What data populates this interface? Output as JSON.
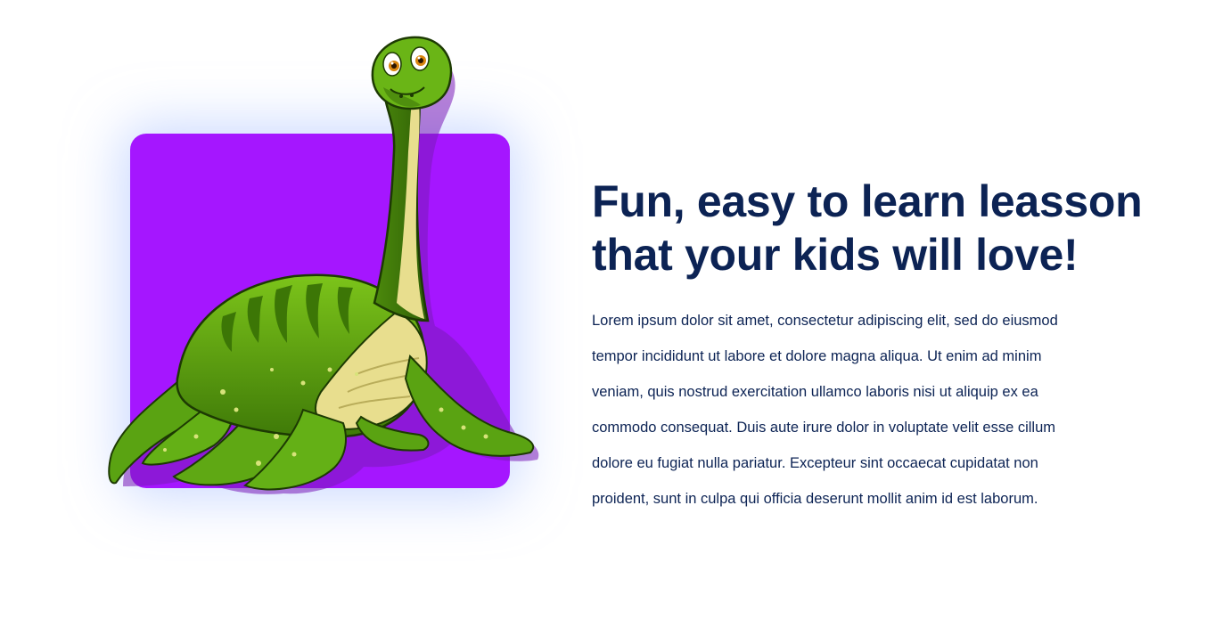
{
  "colors": {
    "card_purple": "#a516ff",
    "card_glow": "#a0b9ff",
    "heading_navy": "#0c2354",
    "dino_green": "#5aa312",
    "dino_belly": "#e8de8e"
  },
  "illustration": {
    "subject": "cartoon green plesiosaur dinosaur",
    "icon": "dinosaur-illustration"
  },
  "section": {
    "heading_line1": "Fun, easy to learn leasson",
    "heading_line2": "that your kids will love!",
    "body": "Lorem ipsum dolor sit amet, consectetur adipiscing elit, sed do eiusmod tempor incididunt ut labore et dolore magna aliqua. Ut enim ad minim veniam, quis nostrud exercitation ullamco laboris nisi ut aliquip ex ea commodo consequat. Duis aute irure dolor in voluptate velit esse cillum dolore eu fugiat nulla pariatur. Excepteur sint occaecat cupidatat non proident, sunt in culpa qui officia deserunt mollit anim id est laborum."
  }
}
